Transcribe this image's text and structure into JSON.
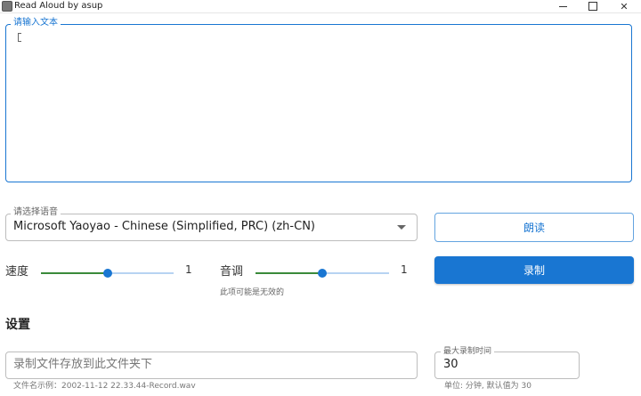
{
  "window": {
    "title": "Read Aloud by asup",
    "controls": {
      "minimize": "minimize-icon",
      "maximize": "maximize-icon",
      "close": "close-icon"
    }
  },
  "text_input": {
    "label": "请输入文本",
    "value": ""
  },
  "voice_select": {
    "label": "请选择语音",
    "value": "Microsoft Yaoyao - Chinese (Simplified, PRC) (zh-CN)"
  },
  "buttons": {
    "read": "朗读",
    "record": "录制"
  },
  "speed": {
    "label": "速度",
    "value": "1",
    "fill_fraction": 0.5
  },
  "pitch": {
    "label": "音调",
    "value": "1",
    "fill_fraction": 0.5,
    "hint": "此项可能是无效的"
  },
  "settings": {
    "title": "设置",
    "folder": {
      "placeholder": "录制文件存放到此文件夹下",
      "hint": "文件名示例：2002-11-12 22.33.44-Record.wav"
    },
    "max_time": {
      "label": "最大录制时间",
      "value": "30",
      "hint": "单位: 分钟, 默认值为 30"
    }
  },
  "colors": {
    "accent": "#1976d2",
    "slider_fill": "#3a8a3a",
    "slider_track": "#b7d3f2"
  }
}
